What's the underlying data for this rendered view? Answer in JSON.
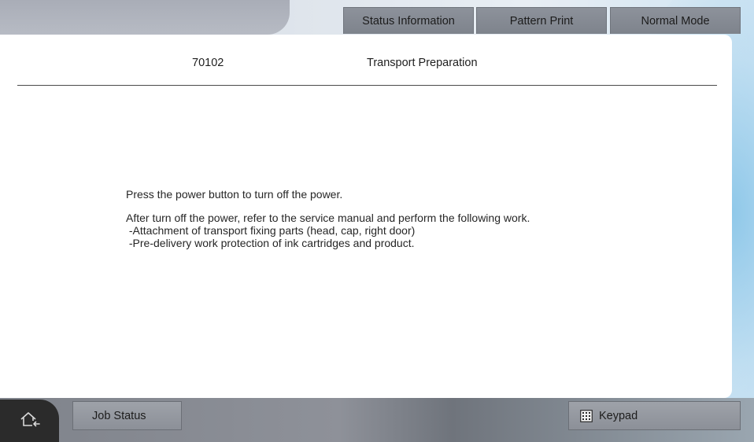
{
  "tabs": {
    "status_information": "Status Information",
    "pattern_print": "Pattern Print",
    "normal_mode": "Normal Mode"
  },
  "header": {
    "code": "70102",
    "title": "Transport Preparation"
  },
  "message": {
    "line1": "Press the power button to turn off the power.",
    "line2": "After turn off the power, refer to the service manual and perform the following work.",
    "line3": " -Attachment of transport fixing parts (head, cap, right door)",
    "line4": " -Pre-delivery work protection of ink cartridges and product."
  },
  "bottom": {
    "job_status_label": "Job Status",
    "keypad_label": "Keypad"
  },
  "icons": {
    "home": "home-back-icon",
    "keypad": "keypad-icon"
  },
  "colors": {
    "tab_bg": "#858a93",
    "panel_bg": "#ffffff",
    "home_bg": "#2b2b2b"
  }
}
